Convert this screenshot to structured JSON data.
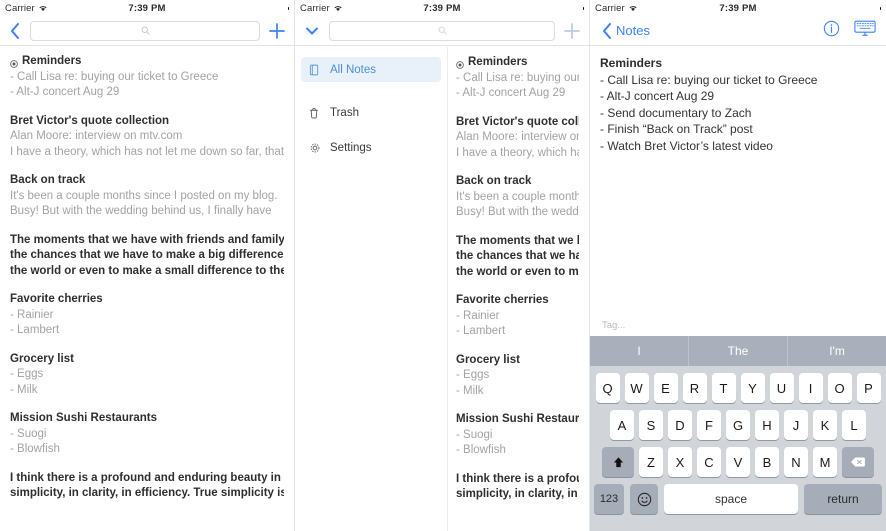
{
  "status_bar": {
    "carrier": "Carrier",
    "time": "7:39 PM"
  },
  "panels": {
    "left": {
      "nav": {
        "back_icon": "chevron-left-icon",
        "search_placeholder": "",
        "add_icon": "plus-icon"
      },
      "notes": [
        {
          "title": "Reminders",
          "pinned": true,
          "lines": [
            "- Call Lisa re: buying our ticket to Greece",
            "- Alt-J concert Aug 29"
          ]
        },
        {
          "title": "Bret Victor's quote collection",
          "pinned": false,
          "lines": [
            "Alan Moore: interview on mtv.com",
            "I have a theory, which has not let me down so far, that"
          ]
        },
        {
          "title": "Back on track",
          "pinned": false,
          "lines": [
            "It's been a couple months since I posted on my blog.",
            "Busy! But with the wedding behind us, I finally have"
          ]
        },
        {
          "title": "The moments that we have with friends and family,",
          "title_extra": [
            "the chances that we have to make a big difference in",
            "the world or even to make a small difference to the"
          ],
          "pinned": false,
          "lines": []
        },
        {
          "title": "Favorite cherries",
          "pinned": false,
          "lines": [
            "- Rainier",
            "- Lambert"
          ]
        },
        {
          "title": "Grocery list",
          "pinned": false,
          "lines": [
            "- Eggs",
            "- Milk"
          ]
        },
        {
          "title": "Mission Sushi Restaurants",
          "pinned": false,
          "lines": [
            "- Suogi",
            "- Blowfish"
          ]
        },
        {
          "title": "I think there is a profound and enduring beauty in",
          "title_extra": [
            "simplicity, in clarity, in efficiency. True simplicity is"
          ],
          "pinned": false,
          "lines": []
        }
      ]
    },
    "middle": {
      "nav": {
        "collapse_icon": "chevron-down-icon",
        "search_placeholder": "",
        "add_icon": "plus-icon"
      },
      "drawer": {
        "items": [
          {
            "label": "All Notes",
            "icon": "note-icon",
            "active": true
          },
          {
            "label": "Trash",
            "icon": "trash-icon",
            "active": false
          },
          {
            "label": "Settings",
            "icon": "gear-icon",
            "active": false
          }
        ]
      },
      "notes": [
        {
          "title": "Reminders",
          "pinned": true,
          "lines": [
            "- Call Lisa re: buying our tic",
            "- Alt-J concert Aug 29"
          ]
        },
        {
          "title": "Bret Victor's quote collecti",
          "pinned": false,
          "lines": [
            "Alan Moore: interview on m",
            "I have a theory, which has"
          ]
        },
        {
          "title": "Back on track",
          "pinned": false,
          "lines": [
            "It's been a couple months",
            "Busy! But with the weddin"
          ]
        },
        {
          "title": "The moments that we hav",
          "title_extra": [
            "the chances that we have t",
            "the world or even to make"
          ],
          "pinned": false,
          "lines": []
        },
        {
          "title": "Favorite cherries",
          "pinned": false,
          "lines": [
            "- Rainier",
            "- Lambert"
          ]
        },
        {
          "title": "Grocery list",
          "pinned": false,
          "lines": [
            "- Eggs",
            "- Milk"
          ]
        },
        {
          "title": "Mission Sushi Restaurants",
          "pinned": false,
          "lines": [
            "- Suogi",
            "- Blowfish"
          ]
        },
        {
          "title": "I think there is a profound",
          "title_extra": [
            "simplicity, in clarity, in effi"
          ],
          "pinned": false,
          "lines": []
        }
      ]
    },
    "right": {
      "nav": {
        "back_label": "Notes",
        "back_icon": "chevron-left-icon",
        "info_icon": "info-circle-icon",
        "keyboard_icon": "keyboard-icon"
      },
      "editor": {
        "lines": [
          "Reminders",
          "- Call Lisa re: buying our ticket to Greece",
          "- Alt-J concert Aug 29",
          "- Send documentary to Zach",
          "- Finish “Back on Track” post",
          "- Watch Bret Victor’s latest video"
        ]
      },
      "tag_placeholder": "Tag...",
      "keyboard": {
        "suggestions": [
          "I",
          "The",
          "I'm"
        ],
        "row1": [
          "Q",
          "W",
          "E",
          "R",
          "T",
          "Y",
          "U",
          "I",
          "O",
          "P"
        ],
        "row2": [
          "A",
          "S",
          "D",
          "F",
          "G",
          "H",
          "J",
          "K",
          "L"
        ],
        "row3": [
          "Z",
          "X",
          "C",
          "V",
          "B",
          "N",
          "M"
        ],
        "shift_label": "shift-icon",
        "delete_label": "delete-icon",
        "numbers_label": "123",
        "emoji_label": "emoji-icon",
        "space_label": "space",
        "return_label": "return"
      }
    }
  },
  "colors": {
    "accent": "#3a82f7",
    "keyboard_bg": "#d1d5da",
    "predict_bg": "#a9b0bb",
    "active_drawer_bg": "#e8f0fa"
  }
}
